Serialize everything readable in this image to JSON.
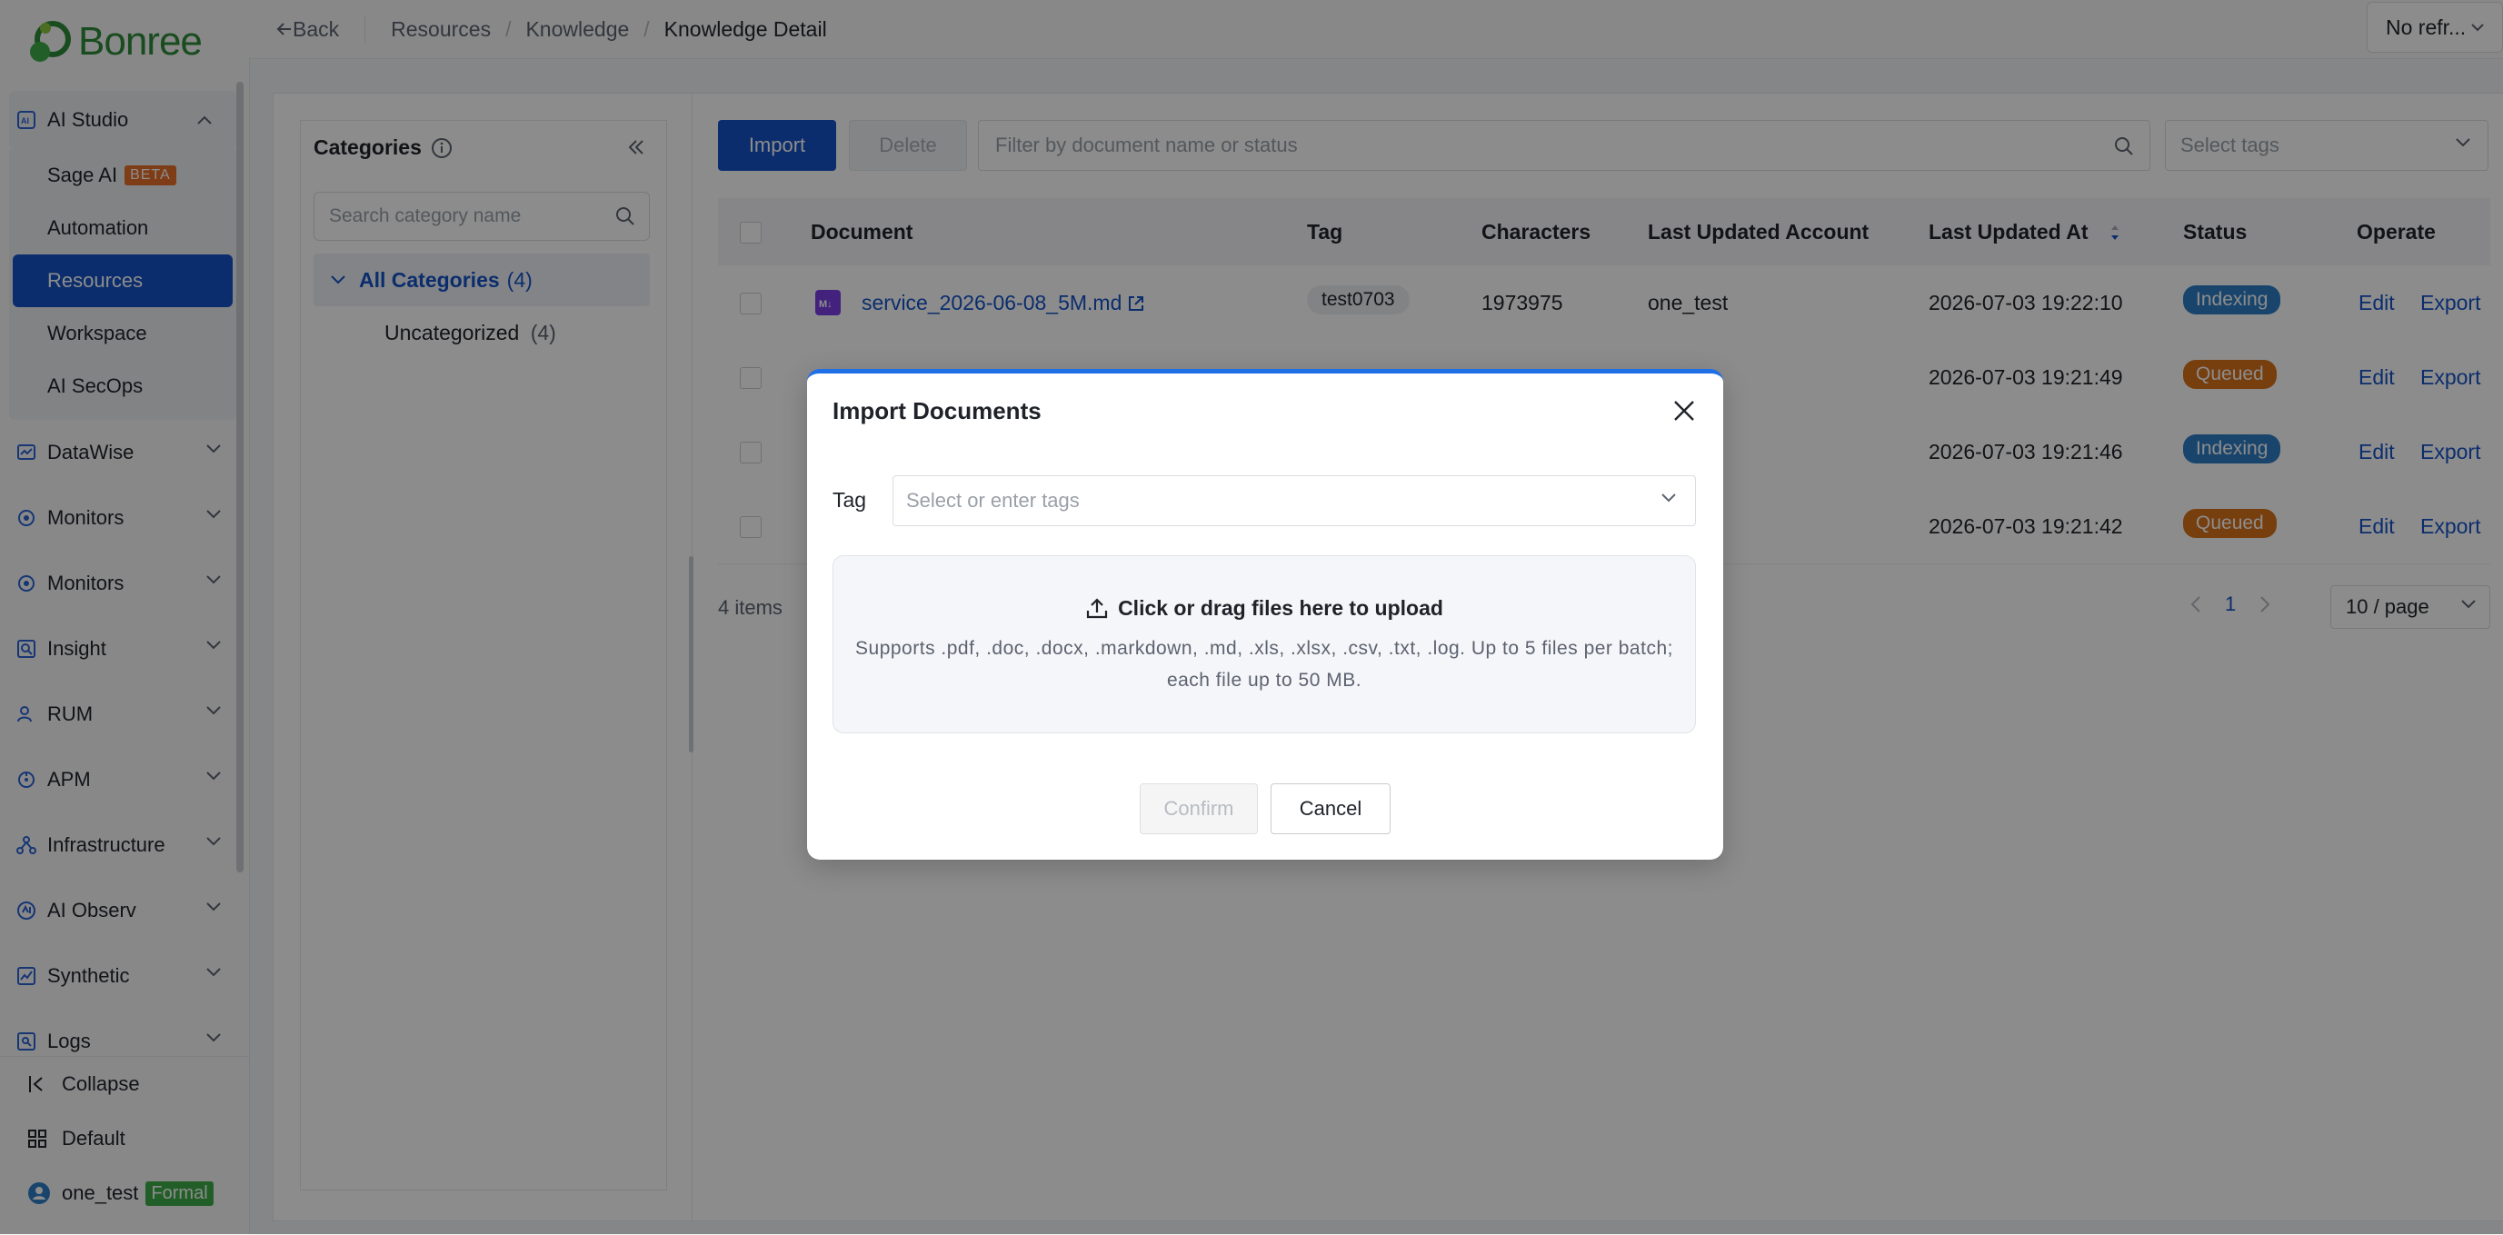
{
  "app": {
    "brand": "Bonree",
    "brand_color": "#2f8a3a",
    "accent": "#1553c7"
  },
  "sidebar": {
    "groups": [
      {
        "label": "AI Studio",
        "icon": "ai-studio-icon",
        "expanded": true,
        "items": [
          {
            "label": "Sage AI",
            "badge": "BETA"
          },
          {
            "label": "Automation"
          },
          {
            "label": "Resources",
            "active": true
          },
          {
            "label": "Workspace"
          },
          {
            "label": "AI SecOps"
          }
        ]
      },
      {
        "label": "DataWise",
        "icon": "datawise-icon"
      },
      {
        "label": "Monitors",
        "icon": "monitors-icon"
      },
      {
        "label": "Monitors",
        "icon": "monitors-icon"
      },
      {
        "label": "Insight",
        "icon": "insight-icon"
      },
      {
        "label": "RUM",
        "icon": "rum-icon"
      },
      {
        "label": "APM",
        "icon": "apm-icon"
      },
      {
        "label": "Infrastructure",
        "icon": "infrastructure-icon"
      },
      {
        "label": "AI Observ",
        "icon": "ai-observ-icon"
      },
      {
        "label": "Synthetic",
        "icon": "synthetic-icon"
      },
      {
        "label": "Logs",
        "icon": "logs-icon"
      }
    ],
    "bottom": {
      "collapse": "Collapse",
      "default": "Default",
      "user": "one_test",
      "user_badge": "Formal"
    }
  },
  "topbar": {
    "back": "Back",
    "breadcrumbs": [
      "Resources",
      "Knowledge",
      "Knowledge Detail"
    ],
    "refresh": "No refr..."
  },
  "categories": {
    "title": "Categories",
    "search_placeholder": "Search category name",
    "all": {
      "label": "All Categories",
      "count": "(4)"
    },
    "uncategorized": {
      "label": "Uncategorized",
      "count": "(4)"
    }
  },
  "toolbar": {
    "import": "Import",
    "delete": "Delete",
    "filter_placeholder": "Filter by document name or status",
    "tags_placeholder": "Select tags"
  },
  "table": {
    "columns": [
      "Document",
      "Tag",
      "Characters",
      "Last Updated Account",
      "Last Updated At",
      "Status",
      "Operate"
    ],
    "rows": [
      {
        "document": "service_2026-06-08_5M.md",
        "tag": "test0703",
        "characters": "1973975",
        "account": "one_test",
        "updated": "2026-07-03 19:22:10",
        "status": "Indexing",
        "edit": "Edit",
        "export": "Export"
      },
      {
        "document": "",
        "tag": "",
        "characters": "",
        "account": "st",
        "updated": "2026-07-03 19:21:49",
        "status": "Queued",
        "edit": "Edit",
        "export": "Export"
      },
      {
        "document": "",
        "tag": "",
        "characters": "",
        "account": "st",
        "updated": "2026-07-03 19:21:46",
        "status": "Indexing",
        "edit": "Edit",
        "export": "Export"
      },
      {
        "document": "",
        "tag": "",
        "characters": "",
        "account": "st",
        "updated": "2026-07-03 19:21:42",
        "status": "Queued",
        "edit": "Edit",
        "export": "Export"
      }
    ],
    "total": "4 items",
    "page": "1",
    "page_size": "10 / page"
  },
  "modal": {
    "title": "Import Documents",
    "tag_label": "Tag",
    "tag_placeholder": "Select or enter tags",
    "upload_title": "Click or drag files here to upload",
    "upload_desc": "Supports .pdf, .doc, .docx, .markdown, .md, .xls, .xlsx, .csv, .txt, .log. Up to 5 files per batch; each file up to 50 MB.",
    "confirm": "Confirm",
    "cancel": "Cancel"
  },
  "colors": {
    "indexing": "#2f7fc7",
    "queued": "#d9721a"
  }
}
